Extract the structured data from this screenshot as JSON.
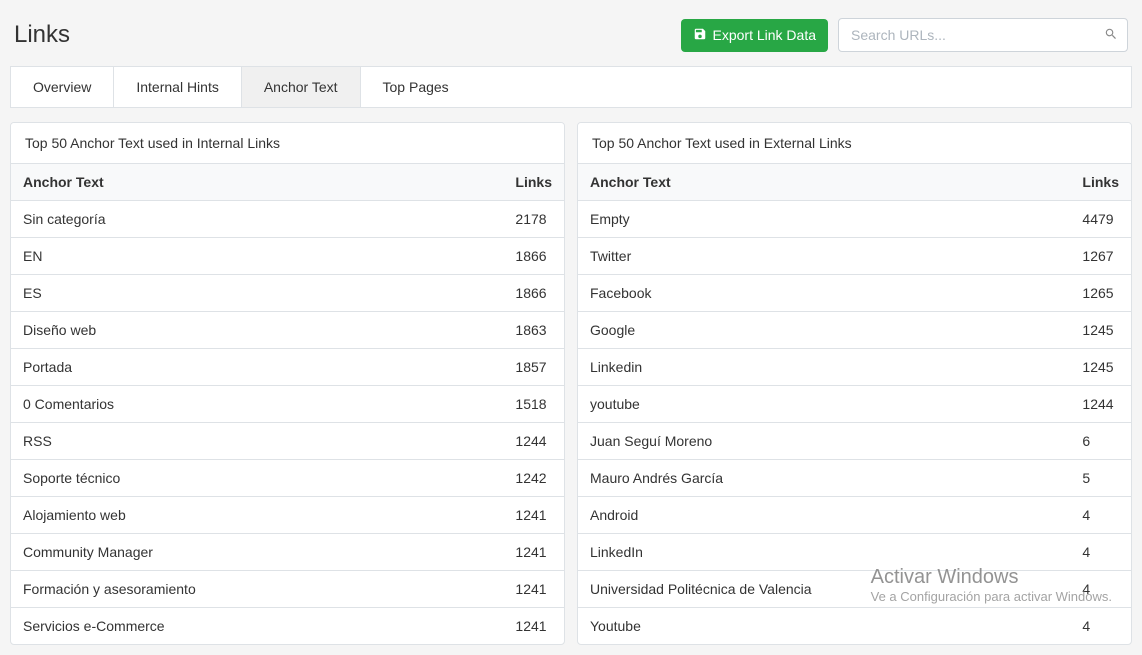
{
  "header": {
    "title": "Links",
    "export_label": "Export Link Data",
    "search_placeholder": "Search URLs..."
  },
  "tabs": [
    {
      "label": "Overview"
    },
    {
      "label": "Internal Hints"
    },
    {
      "label": "Anchor Text"
    },
    {
      "label": "Top Pages"
    }
  ],
  "internal": {
    "title": "Top 50 Anchor Text used in Internal Links",
    "col_anchor": "Anchor Text",
    "col_links": "Links",
    "rows": [
      {
        "text": "Sin categoría",
        "count": "2178"
      },
      {
        "text": "EN",
        "count": "1866"
      },
      {
        "text": "ES",
        "count": "1866"
      },
      {
        "text": "Diseño web",
        "count": "1863"
      },
      {
        "text": "Portada",
        "count": "1857"
      },
      {
        "text": "0 Comentarios",
        "count": "1518"
      },
      {
        "text": "RSS",
        "count": "1244"
      },
      {
        "text": "Soporte técnico",
        "count": "1242"
      },
      {
        "text": "Alojamiento web",
        "count": "1241"
      },
      {
        "text": "Community Manager",
        "count": "1241"
      },
      {
        "text": "Formación y asesoramiento",
        "count": "1241"
      },
      {
        "text": "Servicios e-Commerce",
        "count": "1241"
      }
    ]
  },
  "external": {
    "title": "Top 50 Anchor Text used in External Links",
    "col_anchor": "Anchor Text",
    "col_links": "Links",
    "rows": [
      {
        "text": "Empty",
        "count": "4479"
      },
      {
        "text": "Twitter",
        "count": "1267"
      },
      {
        "text": "Facebook",
        "count": "1265"
      },
      {
        "text": "Google",
        "count": "1245"
      },
      {
        "text": "Linkedin",
        "count": "1245"
      },
      {
        "text": "youtube",
        "count": "1244"
      },
      {
        "text": "Juan Seguí Moreno",
        "count": "6"
      },
      {
        "text": "Mauro Andrés García",
        "count": "5"
      },
      {
        "text": "Android",
        "count": "4"
      },
      {
        "text": "LinkedIn",
        "count": "4"
      },
      {
        "text": "Universidad Politécnica de Valencia",
        "count": "4"
      },
      {
        "text": "Youtube",
        "count": "4"
      }
    ]
  },
  "watermark": {
    "line1": "Activar Windows",
    "line2": "Ve a Configuración para activar Windows."
  }
}
